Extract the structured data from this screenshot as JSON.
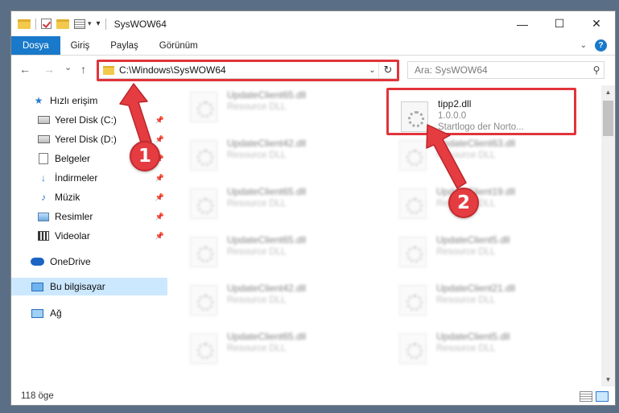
{
  "window": {
    "title": "SysWOW64",
    "controls": {
      "minimize": "—",
      "maximize": "☐",
      "close": "✕"
    }
  },
  "ribbon": {
    "tabs": [
      {
        "label": "Dosya",
        "active": true
      },
      {
        "label": "Giriş"
      },
      {
        "label": "Paylaş"
      },
      {
        "label": "Görünüm"
      }
    ],
    "collapse_icon": "chevron-down-icon",
    "help_label": "?"
  },
  "address": {
    "back": "←",
    "forward": "→",
    "recent": "⌄",
    "up": "↑",
    "path": "C:\\Windows\\SysWOW64",
    "dropdown": "⌄",
    "refresh": "↻"
  },
  "search": {
    "placeholder": "Ara: SysWOW64",
    "icon": "⚲"
  },
  "nav": {
    "items": [
      {
        "label": "Hızlı erişim",
        "icon": "star-icon"
      },
      {
        "label": "Yerel Disk (C:)",
        "icon": "drive-icon",
        "pinned": true
      },
      {
        "label": "Yerel Disk (D:)",
        "icon": "drive-icon",
        "pinned": true
      },
      {
        "label": "Belgeler",
        "icon": "document-icon",
        "pinned": true
      },
      {
        "label": "İndirmeler",
        "icon": "download-icon",
        "pinned": true
      },
      {
        "label": "Müzik",
        "icon": "music-icon",
        "pinned": true
      },
      {
        "label": "Resimler",
        "icon": "pictures-icon",
        "pinned": true
      },
      {
        "label": "Videolar",
        "icon": "video-icon",
        "pinned": true
      },
      {
        "label": "OneDrive",
        "icon": "cloud-icon"
      },
      {
        "label": "Bu bilgisayar",
        "icon": "computer-icon",
        "selected": true
      },
      {
        "label": "Ağ",
        "icon": "network-icon"
      }
    ],
    "pin_glyph": "📌",
    "star_glyph": "★",
    "download_glyph": "↓",
    "music_glyph": "♪"
  },
  "files": {
    "left_column": [
      {
        "name": "UpdateClient65.dll",
        "type": "Resource DLL"
      },
      {
        "name": "UpdateClient42.dll",
        "type": "Resource DLL"
      },
      {
        "name": "UpdateClient65.dll",
        "type": "Resource DLL"
      },
      {
        "name": "UpdateClient65.dll",
        "type": "Resource DLL"
      },
      {
        "name": "UpdateClient42.dll",
        "type": "Resource DLL"
      },
      {
        "name": "UpdateClient65.dll",
        "type": "Resource DLL"
      }
    ],
    "highlighted": {
      "name": "tipp2.dll",
      "version": "1.0.0.0",
      "description": "Startlogo der Norto..."
    },
    "right_column": [
      {
        "name": "UpdateClient63.dll",
        "type": "Resource DLL"
      },
      {
        "name": "UpdateClient19.dll",
        "type": "Resource DLL"
      },
      {
        "name": "UpdateClient5.dll",
        "type": "Resource DLL"
      },
      {
        "name": "UpdateClient21.dll",
        "type": "Resource DLL"
      },
      {
        "name": "UpdateClient5.dll",
        "type": "Resource DLL"
      }
    ]
  },
  "status": {
    "item_count": "118 öge"
  },
  "annotations": {
    "step1": "1",
    "step2": "2",
    "color": "#e53c41"
  }
}
